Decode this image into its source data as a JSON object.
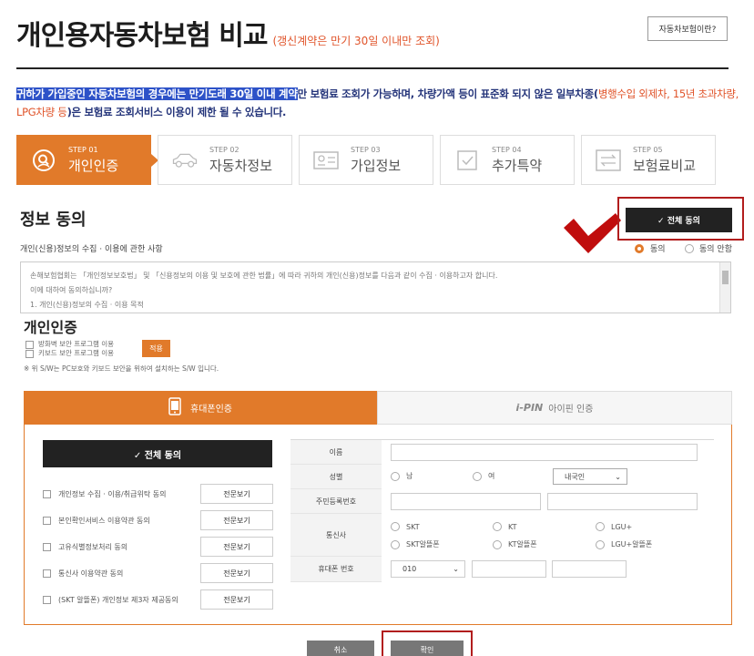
{
  "header": {
    "title": "개인용자동차보험 비교",
    "title_note": "(갱신계약은 만기 30일 이내만 조회)",
    "what_button": "자동차보험이란?"
  },
  "notice": {
    "highlight": "귀하가 가입중인 자동차보험의 경우에는 만기도래 30일 이내 계약",
    "text1": "만 보험료 조회가 가능하며, 차량가액 등이 표준화 되지 않은 일부차종(",
    "red1": "병행수입 외제차, 15년 초과차량,",
    "red2": "LPG차량 등",
    "text2": ")은 보험료 조회서비스 이용이 제한 될 수 있습니다."
  },
  "steps": [
    {
      "no": "STEP 01",
      "name": "개인인증",
      "icon": "person-search-icon"
    },
    {
      "no": "STEP 02",
      "name": "자동차정보",
      "icon": "car-icon"
    },
    {
      "no": "STEP 03",
      "name": "가입정보",
      "icon": "id-card-icon"
    },
    {
      "no": "STEP 04",
      "name": "추가특약",
      "icon": "checkbox-icon"
    },
    {
      "no": "STEP 05",
      "name": "보험료비교",
      "icon": "compare-icon"
    }
  ],
  "consent": {
    "title": "정보 동의",
    "agree_all": "✓ 전체 동의",
    "subtitle": "개인(신용)정보의 수집 · 이용에 관한 사항",
    "agree": "동의",
    "disagree": "동의 안함",
    "text_line1": "손해보험협회는 「개인정보보호법」 및 「신용정보의 이용 및 보호에 관한 법률」에 따라 귀하의 개인(신용)정보를 다음과 같이 수집 · 이용하고자 합니다.",
    "text_line2": "이에 대하여 동의하십니까?",
    "text_line3": "1. 개인(신용)정보의 수집 · 이용 목적"
  },
  "auth": {
    "title": "개인인증",
    "program1": "방화벽 보안 프로그램 이용",
    "program2": "키보드 보안 프로그램 이용",
    "apply": "적용",
    "note": "※ 위 S/W는 PC보호와 키보드 보안을 위하여 설치하는 S/W 입니다.",
    "tab_phone": "휴대폰인증",
    "tab_ipin_logo": "i-PIN",
    "tab_ipin": "아이핀 인증"
  },
  "agreements": {
    "all": "✓ 전체 동의",
    "view": "전문보기",
    "items": [
      "개인정보 수집 · 이용/취급위탁 동의",
      "본인확인서비스 이용약관 동의",
      "고유식별정보처리 동의",
      "통신사 이용약관 동의",
      "(SKT 알뜰폰) 개인정보 제3자 제공동의"
    ]
  },
  "form": {
    "name_label": "이름",
    "gender_label": "성별",
    "male": "남",
    "female": "여",
    "nationality": "내국인",
    "rrn_label": "주민등록번호",
    "carrier_label": "통신사",
    "carriers": [
      "SKT",
      "KT",
      "LGU+",
      "SKT알뜰폰",
      "KT알뜰폰",
      "LGU+알뜰폰"
    ],
    "phone_label": "휴대폰 번호",
    "phone_prefix": "010"
  },
  "buttons": {
    "cancel": "취소",
    "confirm": "확인"
  },
  "colors": {
    "accent": "#e17a2a",
    "annotation_red": "#b21d1d",
    "notice_blue": "#24347a",
    "highlight_blue": "#2d52c8"
  }
}
